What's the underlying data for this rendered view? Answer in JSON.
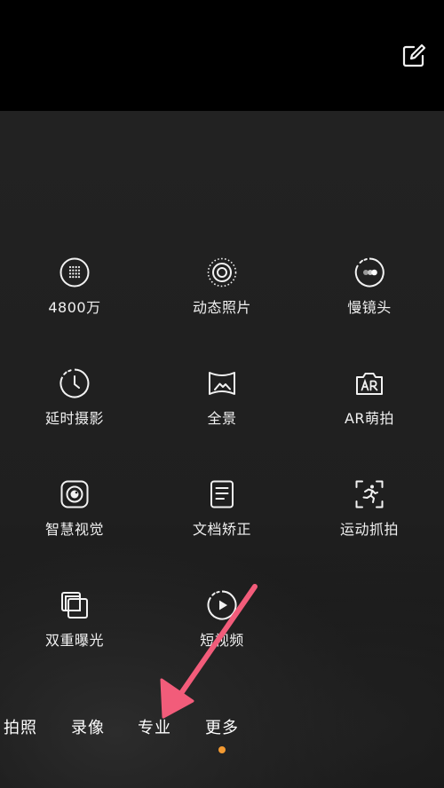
{
  "colors": {
    "accent": "#f39a32",
    "arrow": "#f25c7a",
    "icon": "#f2f2f2",
    "panel": "#222222"
  },
  "header": {
    "edit_icon": "edit-icon"
  },
  "modes": [
    {
      "label": "4800万",
      "icon": "grid-48mp-icon"
    },
    {
      "label": "动态照片",
      "icon": "live-photo-icon"
    },
    {
      "label": "慢镜头",
      "icon": "slow-motion-icon"
    },
    {
      "label": "延时摄影",
      "icon": "timelapse-icon"
    },
    {
      "label": "全景",
      "icon": "panorama-icon"
    },
    {
      "label": "AR萌拍",
      "icon": "ar-camera-icon"
    },
    {
      "label": "智慧视觉",
      "icon": "smart-vision-icon"
    },
    {
      "label": "文档矫正",
      "icon": "document-icon"
    },
    {
      "label": "运动抓拍",
      "icon": "sport-capture-icon"
    },
    {
      "label": "双重曝光",
      "icon": "double-exposure-icon"
    },
    {
      "label": "短视频",
      "icon": "short-video-icon"
    }
  ],
  "tabs": [
    {
      "label": "拍照"
    },
    {
      "label": "录像"
    },
    {
      "label": "专业"
    },
    {
      "label": "更多",
      "active": true
    }
  ]
}
